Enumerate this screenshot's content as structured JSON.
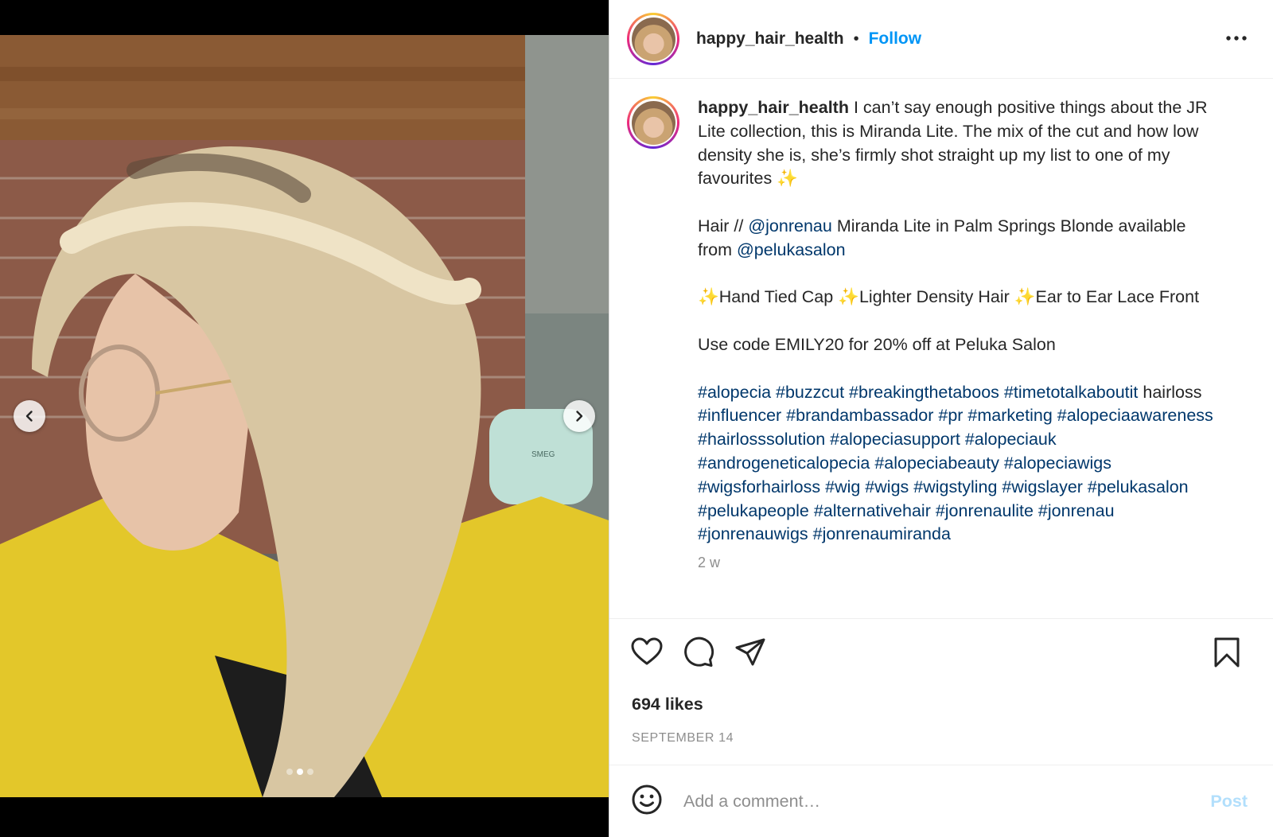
{
  "post": {
    "username": "happy_hair_health",
    "separator": "•",
    "follow_label": "Follow",
    "more_icon": "more-options-icon"
  },
  "media": {
    "prev_icon": "chevron-left-icon",
    "next_icon": "chevron-right-icon",
    "carousel_total": 3,
    "carousel_active_index": 1,
    "appliance_text": "SMEG"
  },
  "caption": {
    "username": "happy_hair_health",
    "p1": " I can’t say enough positive things about the JR Lite collection, this is Miranda Lite. The mix of the cut and how low density she is, she’s firmly shot straight up my list to one of my favourites ",
    "p1_sparkle": "✨",
    "p2_a": "Hair // ",
    "p2_mention1": "@jonrenau",
    "p2_b": " Miranda Lite in Palm Springs Blonde available from ",
    "p2_mention2": "@pelukasalon",
    "p3_s1": "✨",
    "p3_t1": "Hand Tied Cap ",
    "p3_s2": "✨",
    "p3_t2": "Lighter Density Hair ",
    "p3_s3": "✨",
    "p3_t3": "Ear to Ear Lace Front",
    "p4": "Use code EMILY20 for 20% off at Peluka Salon",
    "tags_line1": "#alopecia #buzzcut #breakingthetaboos #timetotalkaboutit",
    "tags_line2_plain": "hairloss ",
    "tags_line2": "#influencer #brandambassador #pr #marketing",
    "tags_rest": "#alopeciaawareness #hairlosssolution #alopeciasupport #alopeciauk #androgeneticalopecia #alopeciabeauty #alopeciawigs #wigsforhairloss #wig #wigs #wigstyling #wigslayer #pelukasalon #pelukapeople #alternativehair #jonrenaulite #jonrenau #jonrenauwigs #jonrenaumiranda",
    "time_ago": "2 w"
  },
  "actions": {
    "like_icon": "heart-icon",
    "comment_icon": "comment-icon",
    "share_icon": "paper-plane-icon",
    "save_icon": "bookmark-icon",
    "likes": "694 likes",
    "date": "SEPTEMBER 14"
  },
  "comment": {
    "emoji_icon": "smiley-icon",
    "placeholder": "Add a comment…",
    "post_label": "Post"
  },
  "colors": {
    "follow": "#0095f6",
    "link": "#00376b",
    "post_disabled": "#b2dffc",
    "muted": "#8e8e8e"
  }
}
